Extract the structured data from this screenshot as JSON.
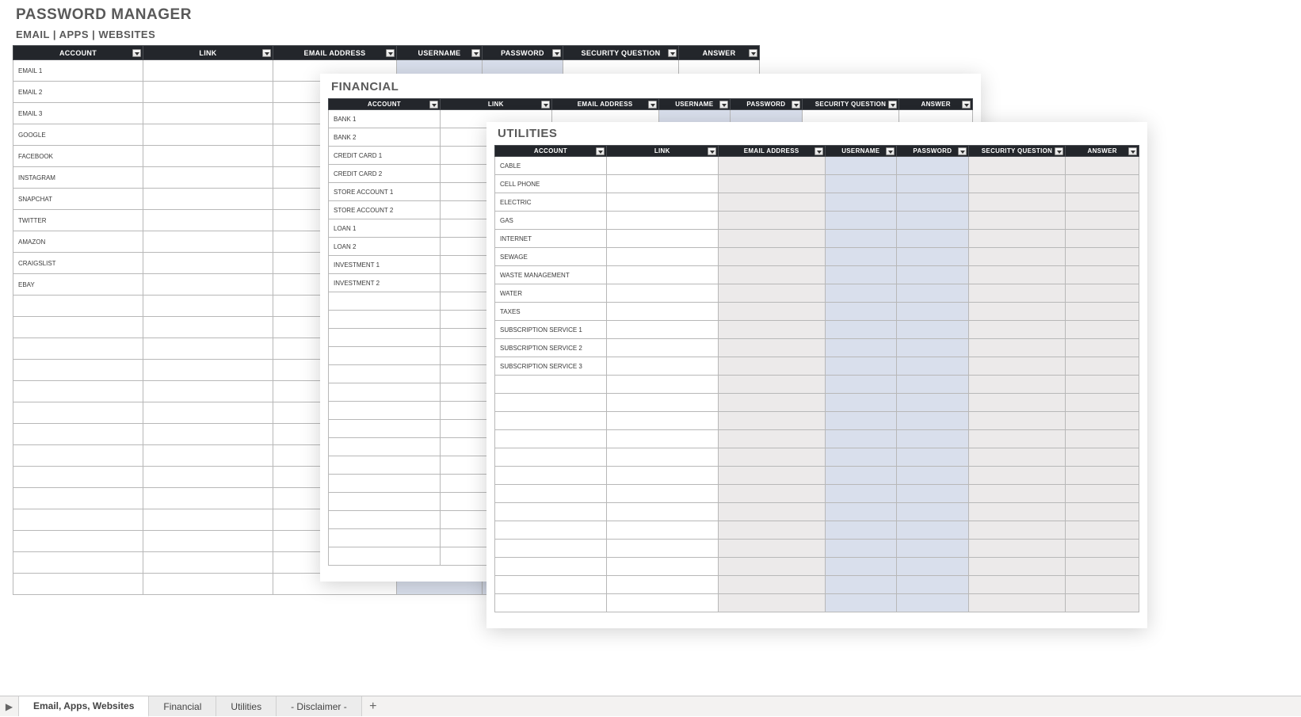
{
  "titles": {
    "main": "PASSWORD MANAGER",
    "sub": "EMAIL | APPS | WEBSITES",
    "financial": "FINANCIAL",
    "utilities": "UTILITIES"
  },
  "columns": [
    "ACCOUNT",
    "LINK",
    "EMAIL ADDRESS",
    "USERNAME",
    "PASSWORD",
    "SECURITY QUESTION",
    "ANSWER"
  ],
  "main_accounts": [
    "EMAIL 1",
    "EMAIL 2",
    "EMAIL 3",
    "GOOGLE",
    "FACEBOOK",
    "INSTAGRAM",
    "SNAPCHAT",
    "TWITTER",
    "AMAZON",
    "CRAIGSLIST",
    "EBAY"
  ],
  "main_blank_rows": 14,
  "fin_accounts": [
    "BANK 1",
    "BANK 2",
    "CREDIT CARD 1",
    "CREDIT CARD 2",
    "STORE ACCOUNT 1",
    "STORE ACCOUNT 2",
    "LOAN 1",
    "LOAN 2",
    "INVESTMENT 1",
    "INVESTMENT 2"
  ],
  "fin_blank_rows": 15,
  "util_accounts": [
    "CABLE",
    "CELL PHONE",
    "ELECTRIC",
    "GAS",
    "INTERNET",
    "SEWAGE",
    "WASTE MANAGEMENT",
    "WATER",
    "TAXES",
    "SUBSCRIPTION SERVICE 1",
    "SUBSCRIPTION SERVICE 2",
    "SUBSCRIPTION SERVICE 3"
  ],
  "util_blank_rows": 13,
  "highlight": {
    "main": {
      "blue": [
        3,
        4
      ],
      "grey": []
    },
    "fin": {
      "blue": [
        3,
        4
      ],
      "grey": []
    },
    "util": {
      "blue": [
        3,
        4
      ],
      "grey": [
        2,
        5,
        6
      ]
    }
  },
  "tabs": {
    "items": [
      "Email, Apps, Websites",
      "Financial",
      "Utilities",
      "- Disclaimer -"
    ],
    "active": 0,
    "add_label": "+",
    "scroll_label": "▶"
  }
}
